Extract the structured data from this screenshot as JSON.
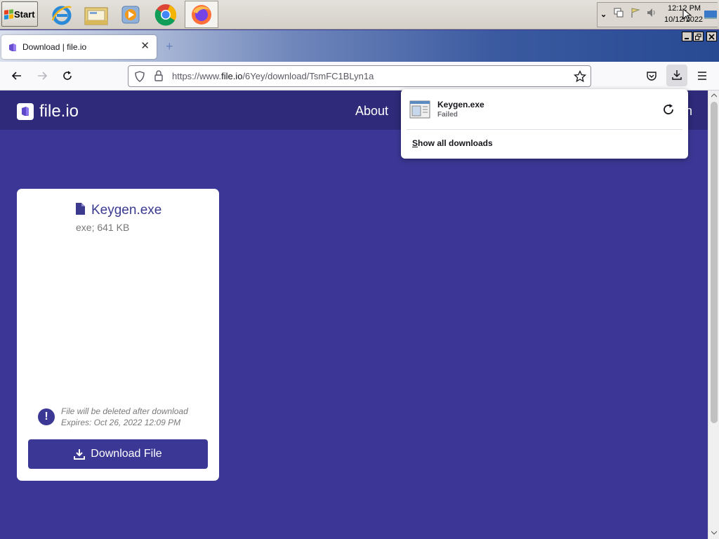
{
  "taskbar": {
    "start_label": "Start",
    "apps": [
      {
        "name": "internet-explorer"
      },
      {
        "name": "file-explorer"
      },
      {
        "name": "media-player"
      },
      {
        "name": "chrome"
      },
      {
        "name": "firefox"
      }
    ],
    "clock": {
      "time": "12:12 PM",
      "date": "10/12/2022"
    }
  },
  "browser": {
    "tab_title": "Download | file.io",
    "new_tab_symbol": "+",
    "url_prefix": "https://www.",
    "url_domain": "file.io",
    "url_path": "/6Yey/download/TsmFC1BLyn1a"
  },
  "site": {
    "logo_text": "file.io",
    "nav_about": "About",
    "nav_clipped": "n"
  },
  "card": {
    "file_name": "Keygen.exe",
    "file_meta": "exe; 641 KB",
    "note_line1": "File will be deleted after download",
    "note_line2": "Expires: Oct 26, 2022 12:09 PM",
    "warn_symbol": "!",
    "download_button": "Download File"
  },
  "downloads_panel": {
    "item_name": "Keygen.exe",
    "item_status": "Failed",
    "show_all_first": "S",
    "show_all_rest": "how all downloads"
  },
  "colors": {
    "page_bg": "#3c3796",
    "header_bg": "#2f2a7a",
    "button_bg": "#3b3795"
  }
}
